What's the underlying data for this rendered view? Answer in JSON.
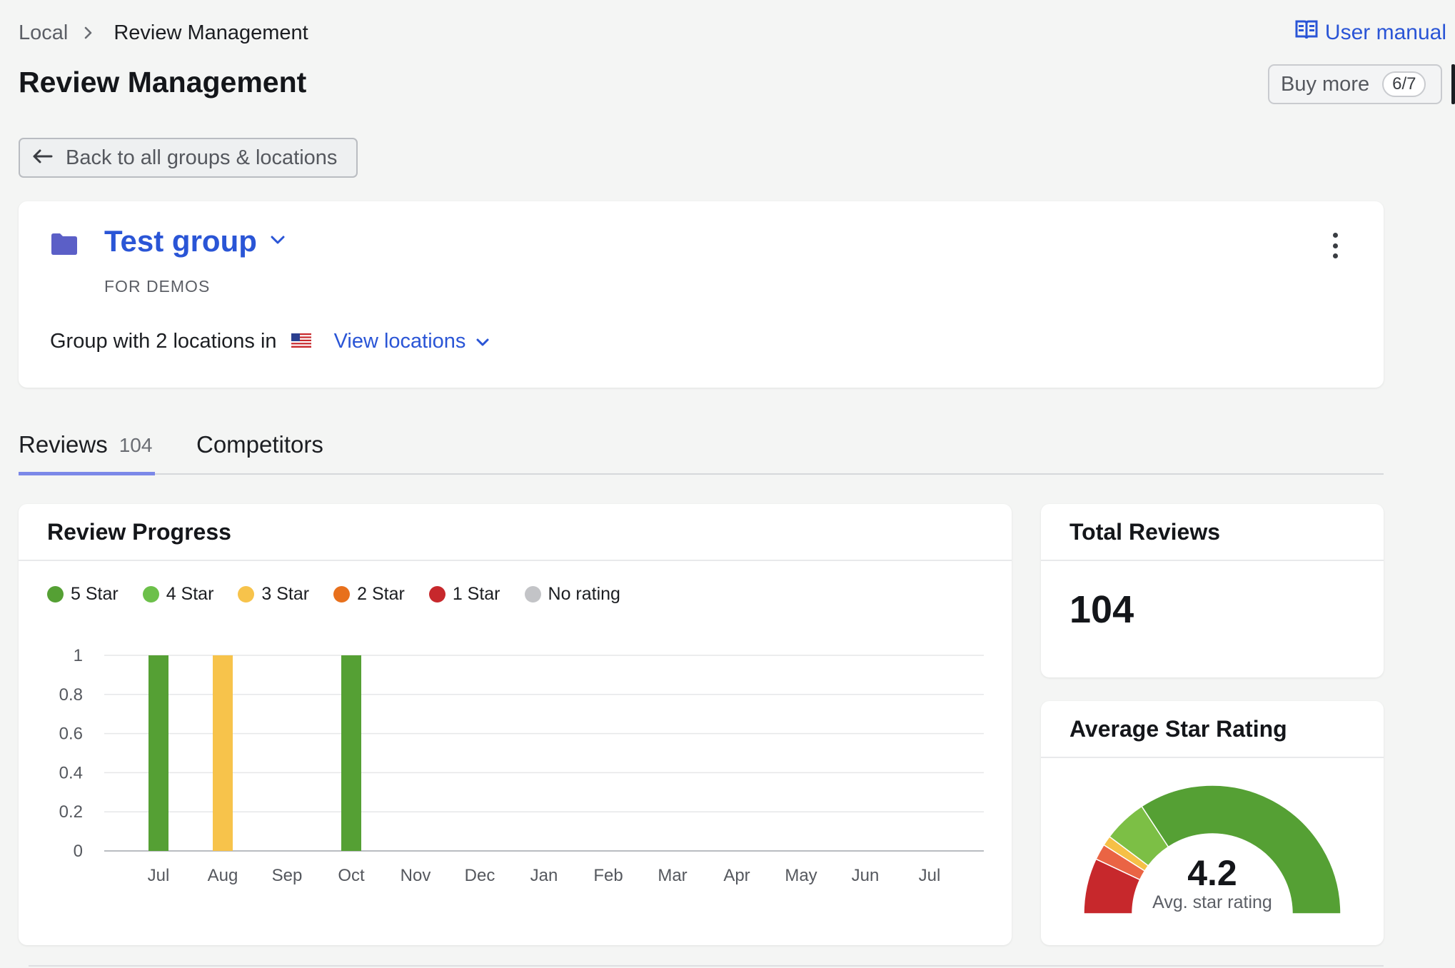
{
  "breadcrumb": {
    "parent": "Local",
    "current": "Review Management"
  },
  "header": {
    "title": "Review Management",
    "manual_label": "User manual",
    "buy_more_label": "Buy more",
    "buy_more_count": "6/7"
  },
  "back_button": {
    "label": "Back to all groups & locations"
  },
  "group": {
    "name": "Test group",
    "subtitle": "FOR DEMOS",
    "locations_text": "Group with 2 locations in",
    "view_locations_label": "View locations"
  },
  "tabs": [
    {
      "label": "Reviews",
      "count": "104"
    },
    {
      "label": "Competitors"
    }
  ],
  "review_progress": {
    "title": "Review Progress"
  },
  "total_reviews": {
    "title": "Total Reviews",
    "value": "104"
  },
  "average_rating": {
    "title": "Average Star Rating",
    "value": "4.2",
    "label": "Avg. star rating"
  },
  "colors": {
    "accent": "#2a55d6",
    "star5": "#55a034",
    "star4": "#6cc04a",
    "star3": "#f7c34b",
    "star2": "#e8701c",
    "star1": "#c7282c",
    "no_rating": "#c3c4c7"
  },
  "chart_data": {
    "type": "bar",
    "legend": [
      {
        "name": "5 Star",
        "color": "#55a034"
      },
      {
        "name": "4 Star",
        "color": "#6cc04a"
      },
      {
        "name": "3 Star",
        "color": "#f7c34b"
      },
      {
        "name": "2 Star",
        "color": "#e8701c"
      },
      {
        "name": "1 Star",
        "color": "#c7282c"
      },
      {
        "name": "No rating",
        "color": "#c3c4c7"
      }
    ],
    "categories": [
      "Jul",
      "Aug",
      "Sep",
      "Oct",
      "Nov",
      "Dec",
      "Jan",
      "Feb",
      "Mar",
      "Apr",
      "May",
      "Jun",
      "Jul"
    ],
    "series": [
      {
        "name": "5 Star",
        "color": "#55a034",
        "values": [
          1,
          0,
          0,
          1,
          0,
          0,
          0,
          0,
          0,
          0,
          0,
          0,
          0
        ]
      },
      {
        "name": "4 Star",
        "color": "#6cc04a",
        "values": [
          0,
          0,
          0,
          0,
          0,
          0,
          0,
          0,
          0,
          0,
          0,
          0,
          0
        ]
      },
      {
        "name": "3 Star",
        "color": "#f7c34b",
        "values": [
          0,
          1,
          0,
          0,
          0,
          0,
          0,
          0,
          0,
          0,
          0,
          0,
          0
        ]
      },
      {
        "name": "2 Star",
        "color": "#e8701c",
        "values": [
          0,
          0,
          0,
          0,
          0,
          0,
          0,
          0,
          0,
          0,
          0,
          0,
          0
        ]
      },
      {
        "name": "1 Star",
        "color": "#c7282c",
        "values": [
          0,
          0,
          0,
          0,
          0,
          0,
          0,
          0,
          0,
          0,
          0,
          0,
          0
        ]
      },
      {
        "name": "No rating",
        "color": "#c3c4c7",
        "values": [
          0,
          0,
          0,
          0,
          0,
          0,
          0,
          0,
          0,
          0,
          0,
          0,
          0
        ]
      }
    ],
    "ylim": [
      0,
      1
    ],
    "yticks": [
      "0",
      "0.2",
      "0.4",
      "0.6",
      "0.8",
      "1"
    ],
    "grid": true,
    "legend_position": "top-left"
  },
  "gauge_data": {
    "type": "half-donut",
    "value": 4.2,
    "segments": [
      {
        "name": "1 Star",
        "color": "#c7282c",
        "share": 0.14
      },
      {
        "name": "2 Star",
        "color": "#ea6444",
        "share": 0.04
      },
      {
        "name": "3 Star",
        "color": "#f5c046",
        "share": 0.025
      },
      {
        "name": "4 Star",
        "color": "#7cbf45",
        "share": 0.11
      },
      {
        "name": "5 Star",
        "color": "#55a034",
        "share": 0.685
      }
    ]
  }
}
